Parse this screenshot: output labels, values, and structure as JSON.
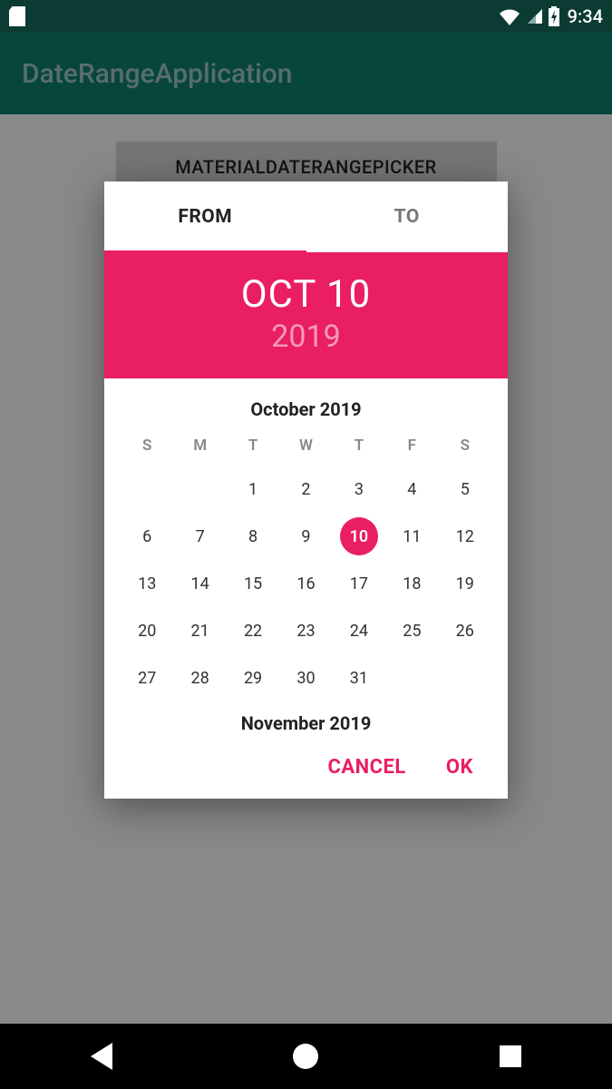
{
  "statusbar": {
    "time": "9:34"
  },
  "appbar": {
    "title": "DateRangeApplication"
  },
  "main": {
    "button_label": "MATERIALDATERANGEPICKER"
  },
  "dialog": {
    "tabs": {
      "from": "FROM",
      "to": "TO"
    },
    "header": {
      "date": "OCT 10",
      "year": "2019"
    },
    "month_title": "October 2019",
    "dow": [
      "S",
      "M",
      "T",
      "W",
      "T",
      "F",
      "S"
    ],
    "weeks": [
      [
        "",
        "",
        "1",
        "2",
        "3",
        "4",
        "5"
      ],
      [
        "6",
        "7",
        "8",
        "9",
        "10",
        "11",
        "12"
      ],
      [
        "13",
        "14",
        "15",
        "16",
        "17",
        "18",
        "19"
      ],
      [
        "20",
        "21",
        "22",
        "23",
        "24",
        "25",
        "26"
      ],
      [
        "27",
        "28",
        "29",
        "30",
        "31",
        "",
        ""
      ]
    ],
    "selected_day": "10",
    "next_month_title": "November 2019",
    "actions": {
      "cancel": "CANCEL",
      "ok": "OK"
    }
  },
  "colors": {
    "accent": "#e91e63",
    "appbar": "#0f8070",
    "statusbar": "#0b3b33"
  }
}
